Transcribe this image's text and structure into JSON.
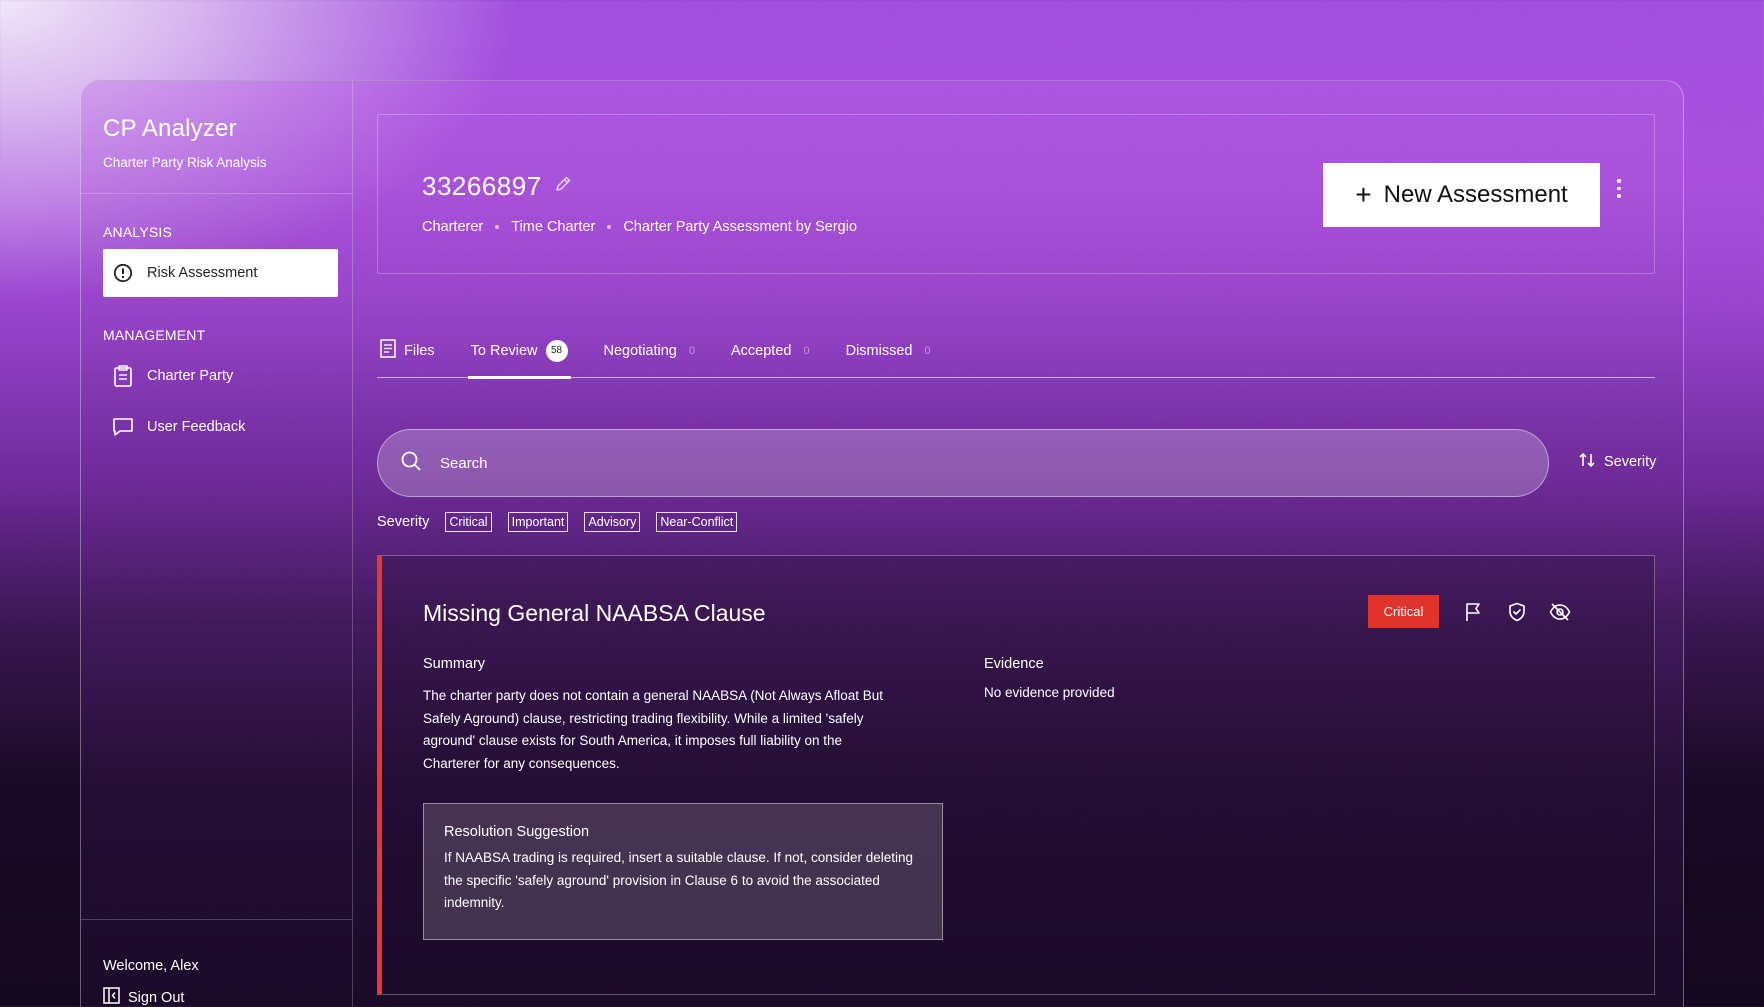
{
  "sidebar": {
    "app_title": "CP Analyzer",
    "app_subtitle": "Charter Party Risk Analysis",
    "sections": [
      {
        "label": "ANALYSIS",
        "items": [
          {
            "label": "Risk Assessment",
            "icon": "alert-circle-icon",
            "active": true
          }
        ]
      },
      {
        "label": "MANAGEMENT",
        "items": [
          {
            "label": "Charter Party",
            "icon": "clipboard-icon"
          },
          {
            "label": "User Feedback",
            "icon": "message-icon"
          }
        ]
      }
    ],
    "welcome": "Welcome, Alex",
    "sign_out": "Sign Out"
  },
  "header": {
    "title": "33266897",
    "meta": [
      "Charterer",
      "Time Charter",
      "Charter Party Assessment by Sergio"
    ],
    "new_button": "New Assessment",
    "new_button_icon": "+"
  },
  "tabs": [
    {
      "label": "Files",
      "icon": "document-icon"
    },
    {
      "label": "To Review",
      "count": "58",
      "active": true
    },
    {
      "label": "Negotiating",
      "count": "0"
    },
    {
      "label": "Accepted",
      "count": "0"
    },
    {
      "label": "Dismissed",
      "count": "0"
    }
  ],
  "search": {
    "placeholder": "Search",
    "sort_label": "Severity"
  },
  "filters": {
    "label": "Severity",
    "chips": [
      "Critical",
      "Important",
      "Advisory",
      "Near-Conflict"
    ]
  },
  "issue": {
    "title": "Missing General NAABSA Clause",
    "severity": "Critical",
    "summary_label": "Summary",
    "summary": "The charter party does not contain a general NAABSA (Not Always Afloat But Safely Aground) clause, restricting trading flexibility. While a limited 'safely aground' clause exists for South America, it imposes full liability on the Charterer for any consequences.",
    "evidence_label": "Evidence",
    "evidence": "No evidence provided",
    "resolution_label": "Resolution Suggestion",
    "resolution": "If NAABSA trading is required, insert a suitable clause. If not, consider deleting the specific 'safely aground' provision in Clause 6 to avoid the associated indemnity."
  },
  "colors": {
    "critical": "#e0332c",
    "accent_border": "#e23a33"
  }
}
